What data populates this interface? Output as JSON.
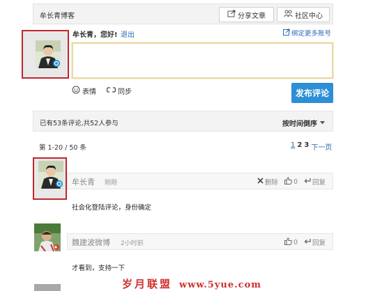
{
  "header": {
    "blog_name": "牟长青博客",
    "share_label": "分享文章",
    "community_label": "社区中心"
  },
  "composer": {
    "greeting": "牟长青，您好!",
    "logout_label": "退出",
    "bind_label": "绑定更多账号",
    "emoji_label": "表情",
    "sync_label": "同步",
    "publish_label": "发布评论"
  },
  "stats": {
    "summary": "已有53条评论,共52人参与",
    "sort_label": "按时间倒序"
  },
  "pagination": {
    "info": "第 1-20 / 50 条",
    "pages": [
      "1",
      "2",
      "3"
    ],
    "next_label": "下一页"
  },
  "comments": [
    {
      "user": "牟长青",
      "time": "刚刚",
      "delete_label": "删除",
      "like_count": "0",
      "reply_label": "回复",
      "text": "社会化登陆评论，身份确定"
    },
    {
      "user": "魏建波微博",
      "time": "2小时前",
      "like_count": "0",
      "reply_label": "回复",
      "text": "才看到，支持一下"
    }
  ],
  "watermark": {
    "site_name": "岁月联盟",
    "url": "www.5yue.com"
  },
  "colors": {
    "link": "#2a6bb1",
    "publish_button": "#2d8fd6",
    "highlight_box": "#c0262c"
  }
}
